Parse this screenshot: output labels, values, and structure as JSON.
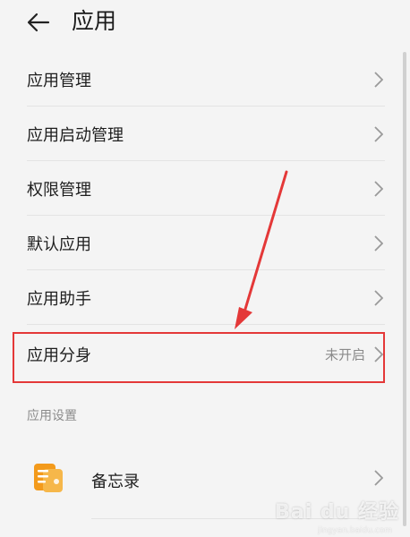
{
  "header": {
    "title": "应用",
    "back_icon": "arrow-left-icon"
  },
  "menu": [
    {
      "label": "应用管理",
      "value": ""
    },
    {
      "label": "应用启动管理",
      "value": ""
    },
    {
      "label": "权限管理",
      "value": ""
    },
    {
      "label": "默认应用",
      "value": ""
    },
    {
      "label": "应用助手",
      "value": ""
    },
    {
      "label": "应用分身",
      "value": "未开启"
    }
  ],
  "section": {
    "title": "应用设置"
  },
  "apps": [
    {
      "label": "备忘录",
      "icon": "memo-app-icon"
    }
  ],
  "colors": {
    "highlight": "#e43838",
    "background": "#f4f4f4",
    "icon_orange": "#f39a1b"
  },
  "watermark": {
    "brand": "Bai du 经验",
    "url": "jingyan.baidu.com"
  }
}
